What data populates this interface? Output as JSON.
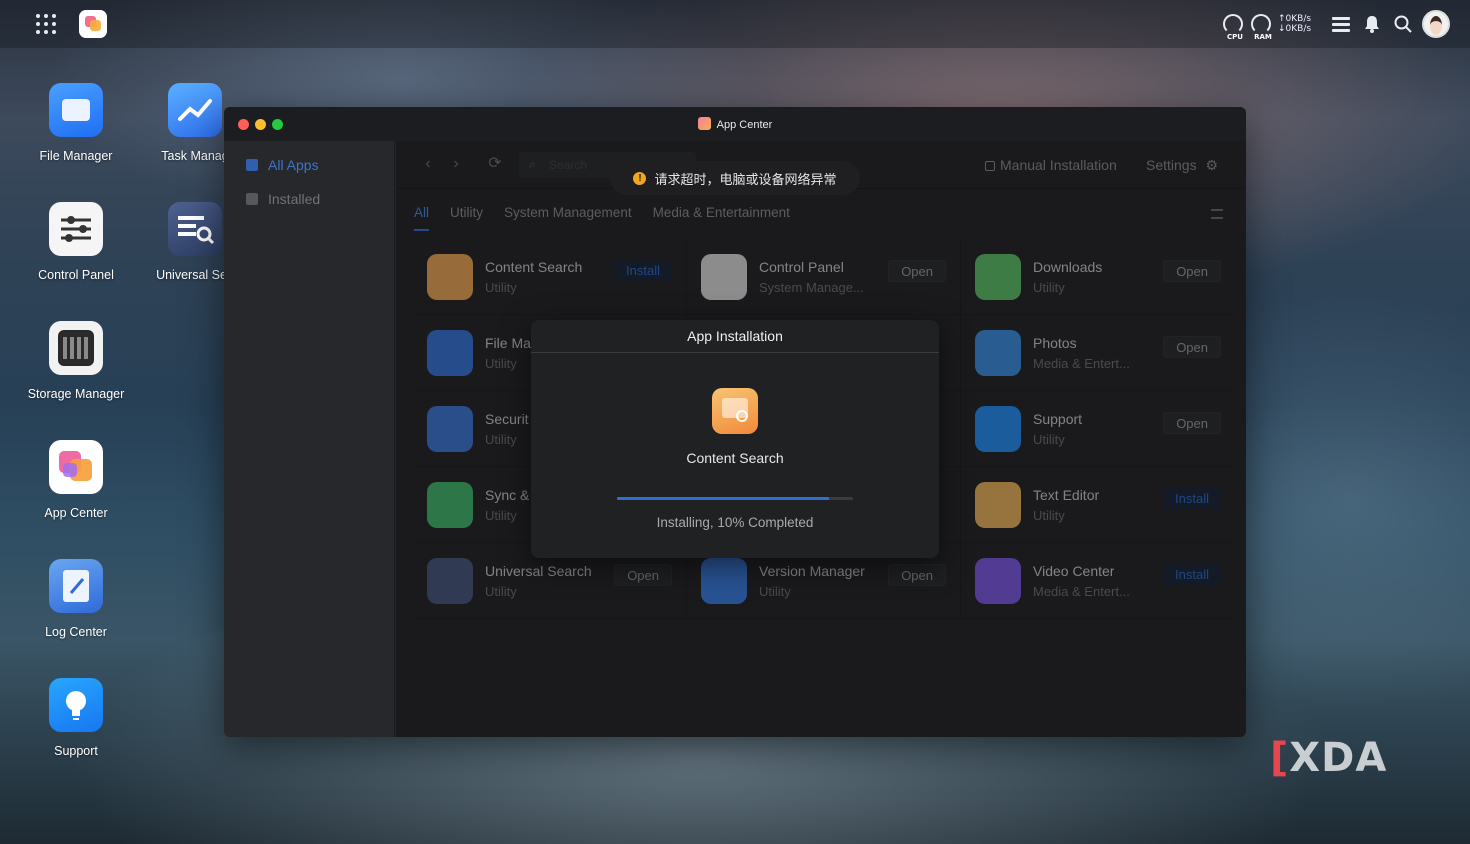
{
  "topbar": {
    "cpu_label": "CPU",
    "ram_label": "RAM",
    "upload_speed": "↑0KB/s",
    "download_speed": "↓0KB/s"
  },
  "desktop": {
    "icons": [
      {
        "label": "File Manager",
        "icon": "folder-icon",
        "color": "#2f7df6"
      },
      {
        "label": "Task Manag",
        "icon": "chart-icon",
        "color": "#3d8df5"
      },
      {
        "label": "Control Panel",
        "icon": "sliders-icon",
        "color": "#ffffff"
      },
      {
        "label": "Universal Sea",
        "icon": "search-list-icon",
        "color": "#3a4d73"
      },
      {
        "label": "Storage Manager",
        "icon": "storage-icon",
        "color": "#ffffff"
      },
      {
        "label": "App Center",
        "icon": "app-center-icon",
        "color": "#ffffff"
      },
      {
        "label": "Log Center",
        "icon": "log-icon",
        "color": "#3b7bd9"
      },
      {
        "label": "Support",
        "icon": "lightbulb-icon",
        "color": "#1b8cff"
      }
    ]
  },
  "window": {
    "title": "App Center",
    "sidebar": [
      {
        "label": "All Apps",
        "active": true
      },
      {
        "label": "Installed",
        "active": false
      }
    ],
    "toolbar": {
      "search_placeholder": "Search",
      "manual_install": "Manual Installation",
      "settings": "Settings"
    },
    "tabs": [
      {
        "label": "All",
        "active": true
      },
      {
        "label": "Utility",
        "active": false
      },
      {
        "label": "System Management",
        "active": false
      },
      {
        "label": "Media & Entertainment",
        "active": false
      }
    ],
    "apps": [
      {
        "name": "Content Search",
        "category": "Utility",
        "action": "Install",
        "color": "#e9a55a"
      },
      {
        "name": "Control Panel",
        "category": "System Manage...",
        "action": "Open",
        "color": "#d8d8d8"
      },
      {
        "name": "Downloads",
        "category": "Utility",
        "action": "Open",
        "color": "#5fbf6a"
      },
      {
        "name": "File Ma",
        "category": "Utility",
        "action": "Open",
        "color": "#3c75d8"
      },
      {
        "name": "",
        "category": "",
        "action": "",
        "color": ""
      },
      {
        "name": "Photos",
        "category": "Media & Entert...",
        "action": "Open",
        "color": "#3f8fe0"
      },
      {
        "name": "Securit",
        "category": "Utility",
        "action": "Open",
        "color": "#3f78d3"
      },
      {
        "name": "",
        "category": "",
        "action": "",
        "color": ""
      },
      {
        "name": "Support",
        "category": "Utility",
        "action": "Open",
        "color": "#2a8ef0"
      },
      {
        "name": "Sync &",
        "category": "Utility",
        "action": "Open",
        "color": "#46b56e"
      },
      {
        "name": "",
        "category": "",
        "action": "",
        "color": ""
      },
      {
        "name": "Text Editor",
        "category": "Utility",
        "action": "Install",
        "color": "#e8b15f"
      },
      {
        "name": "Universal Search",
        "category": "Utility",
        "action": "Open",
        "color": "#4a5a7e"
      },
      {
        "name": "Version Manager",
        "category": "Utility",
        "action": "Open",
        "color": "#3e7fe0"
      },
      {
        "name": "Video Center",
        "category": "Media & Entert...",
        "action": "Install",
        "color": "#7e5be0"
      }
    ]
  },
  "toast": {
    "message": "请求超时，电脑或设备网络异常"
  },
  "dialog": {
    "title": "App Installation",
    "app_name": "Content Search",
    "progress": 0.9,
    "status": "Installing, 10% Completed"
  },
  "watermark": "XDA"
}
